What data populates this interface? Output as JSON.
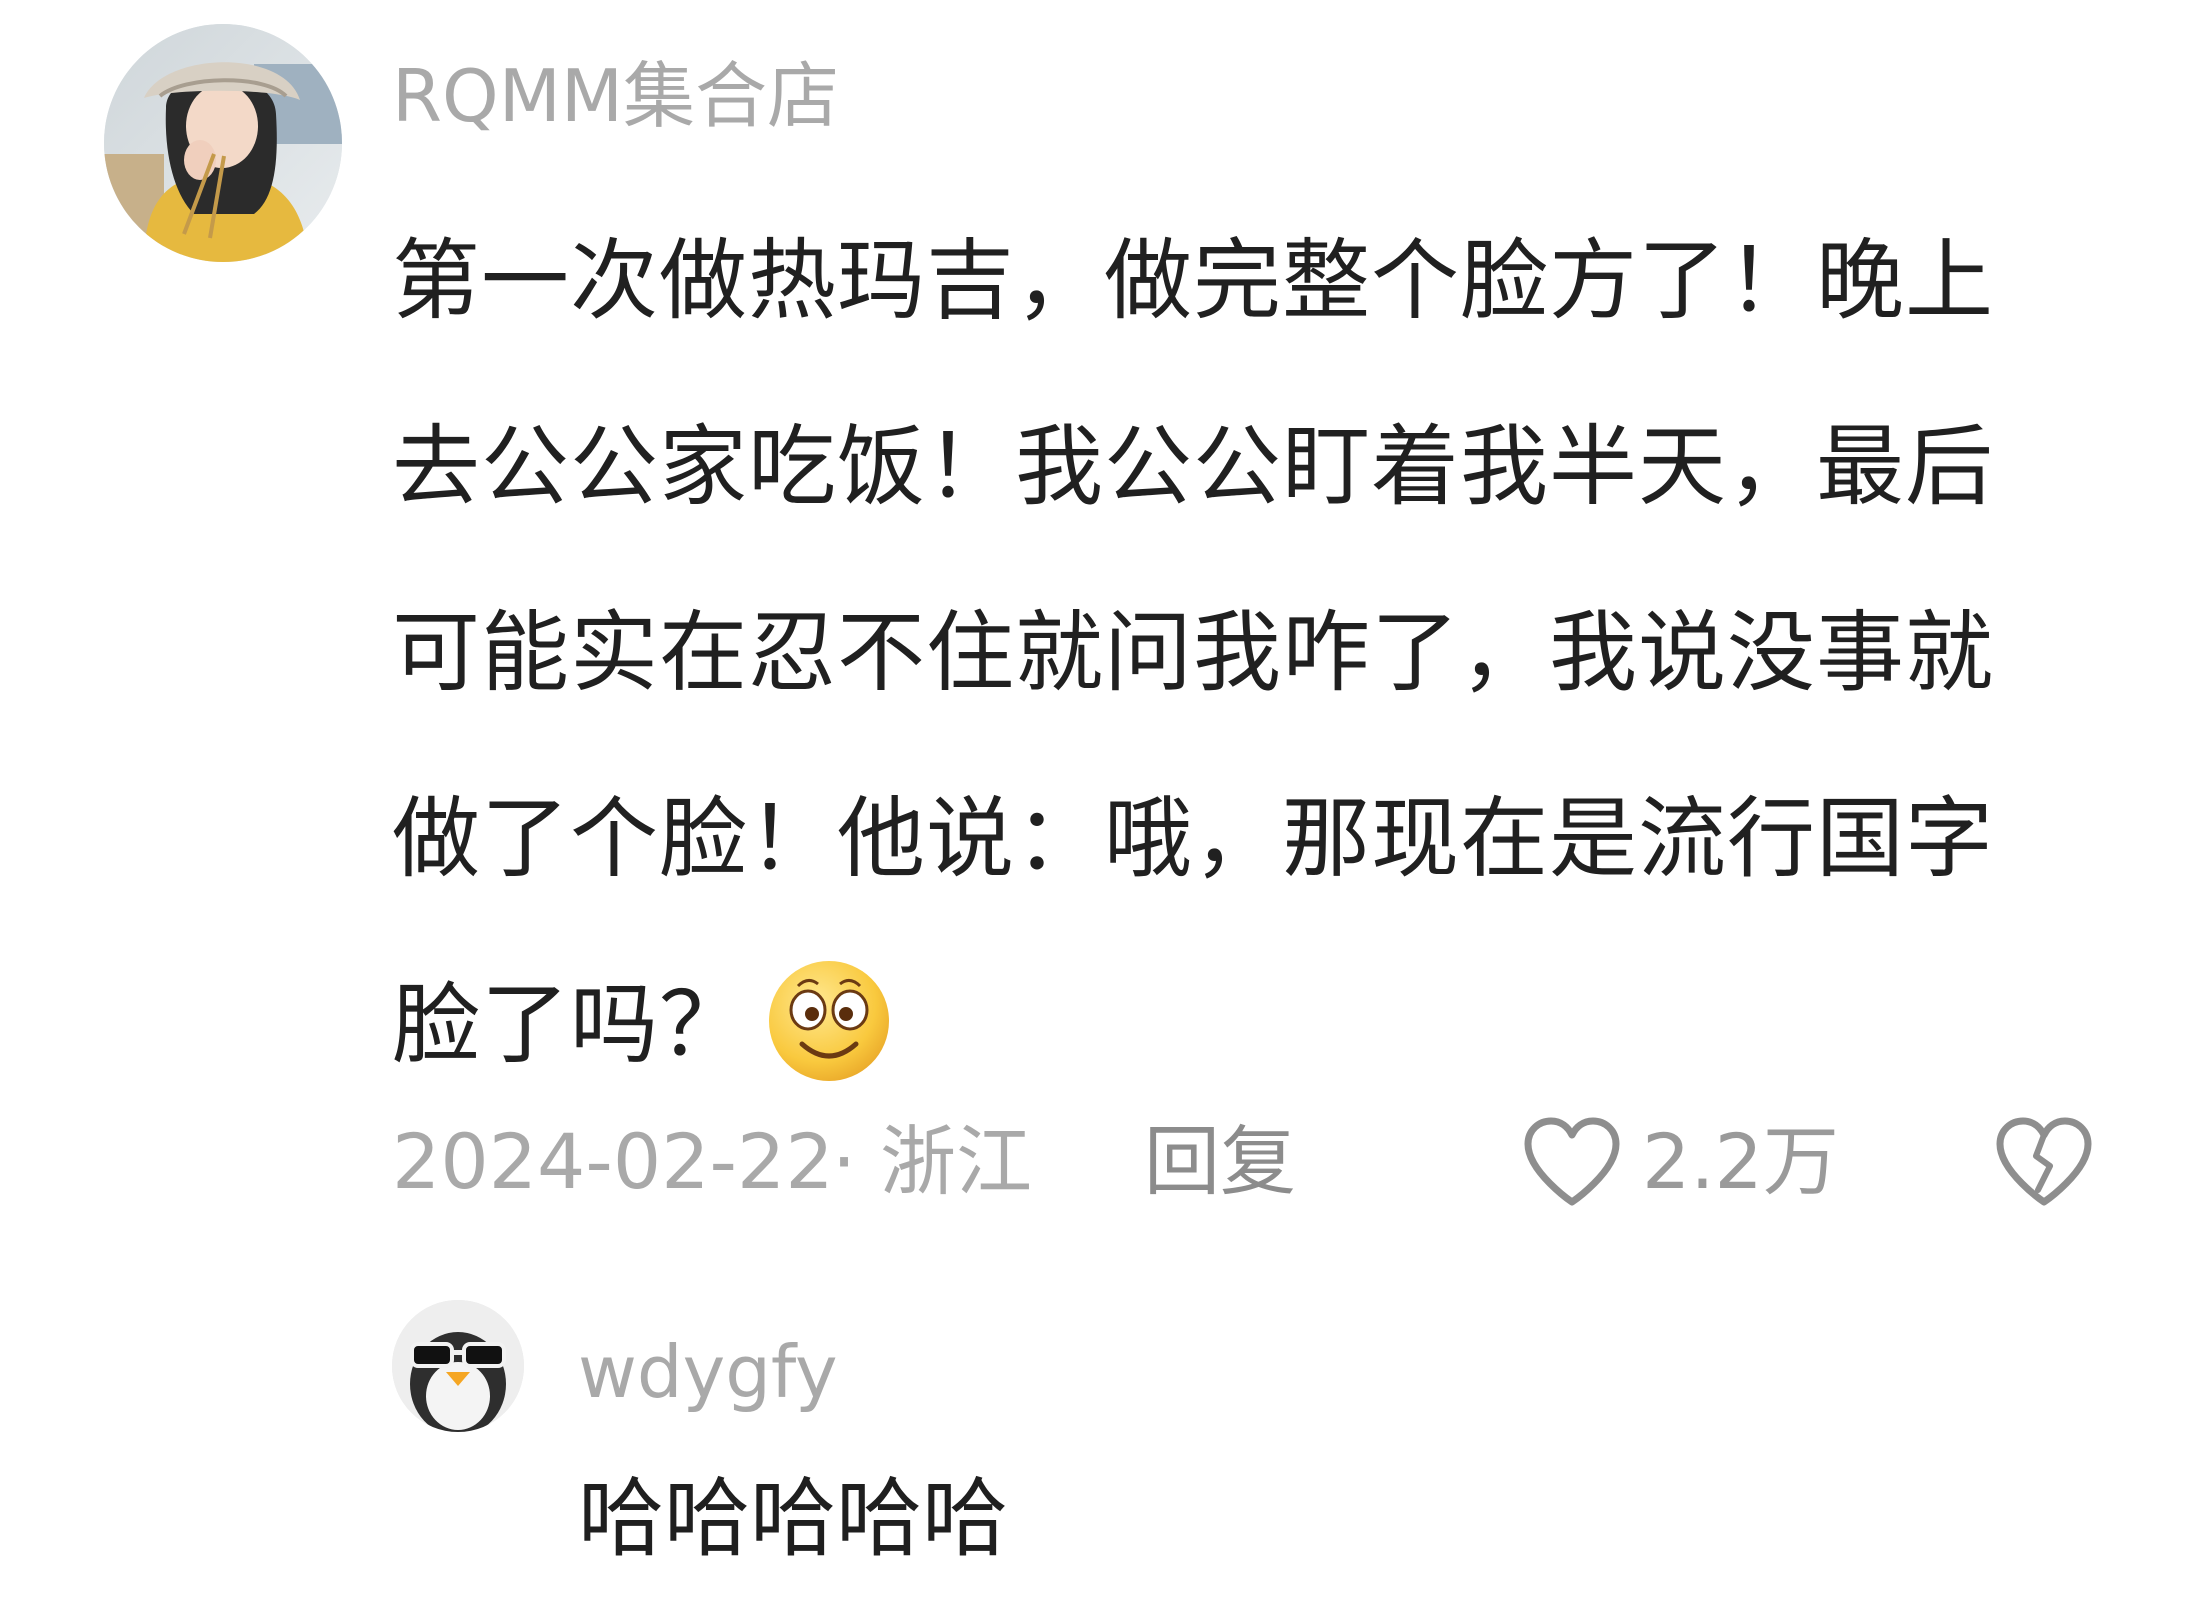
{
  "comment": {
    "username": "RQMM集合店",
    "text_lines": [
      "第一次做热玛吉，做完整个脸方了！晚上",
      "去公公家吃饭！我公公盯着我半天，最后",
      "可能实在忍不住就问我咋了，我说没事就",
      "做了个脸！他说：哦，那现在是流行国字",
      "脸了吗？"
    ],
    "emoji": "smiling-face-emoji",
    "date": "2024-02-22",
    "separator": "·",
    "region": "浙江",
    "reply_label": "回复",
    "like_count": "2.2万",
    "colors": {
      "meta": "#a9a9a9",
      "text": "#202020"
    }
  },
  "reply": {
    "username": "wdygfy",
    "text": "哈哈哈哈哈"
  }
}
